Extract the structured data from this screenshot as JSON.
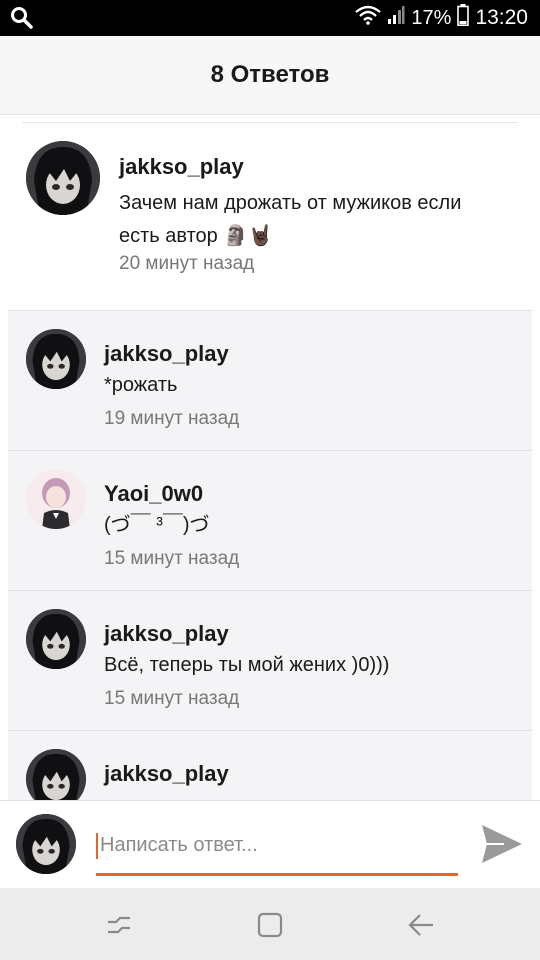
{
  "status_bar": {
    "battery_percent": "17%",
    "time": "13:20",
    "icons": [
      "search-icon",
      "wifi-icon",
      "signal-icon",
      "battery-icon"
    ]
  },
  "header": {
    "title": "8 Ответов"
  },
  "main_comment": {
    "username": "jakkso_play",
    "text_line1": "Зачем нам дрожать от мужиков если",
    "text_line2": "есть автор 🗿🤘🏿",
    "time": "20 минут назад"
  },
  "replies": [
    {
      "username": "jakkso_play",
      "text": "*рожать",
      "time": "19 минут назад"
    },
    {
      "username": "Yaoi_0w0",
      "text": "(づ￣ ³￣)づ",
      "time": "15 минут назад"
    },
    {
      "username": "jakkso_play",
      "text": "Всё, теперь ты мой жених )0)))",
      "time": "15 минут назад"
    },
    {
      "username": "jakkso_play",
      "text": "",
      "time": ""
    }
  ],
  "reply_input": {
    "placeholder": "Написать ответ..."
  },
  "nav_bar": {
    "icons": [
      "recent-apps-icon",
      "home-icon",
      "back-icon"
    ]
  },
  "colors": {
    "accent": "#e0682f",
    "replies_bg": "#f4f4f6",
    "header_bg": "#f7f7f7"
  }
}
